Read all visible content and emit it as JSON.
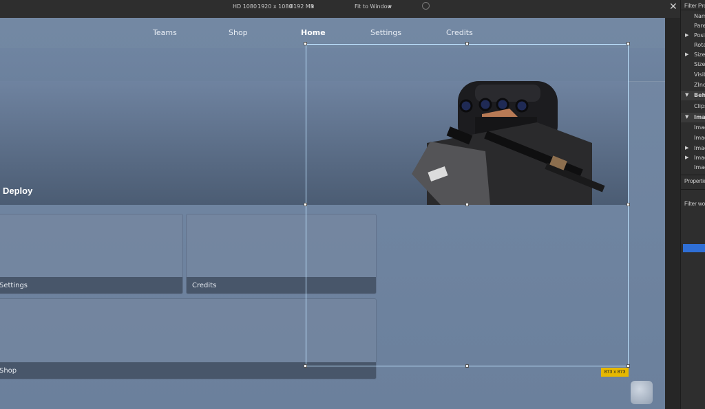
{
  "topbar": {
    "device": "HD 1080",
    "resolution": "1920 x 1080",
    "memory": "8192 MB",
    "fit": "Fit to Window",
    "close": "✕"
  },
  "nav": [
    "Teams",
    "Shop",
    "Home",
    "Settings",
    "Credits"
  ],
  "banner": {
    "label": "Deploy"
  },
  "cards": [
    "Settings",
    "Credits",
    "Shop"
  ],
  "selection": {
    "size_label": "873 x 873",
    "color": "#bfe3ff"
  },
  "panel": {
    "filter_label": "Filter Pro",
    "properties": [
      {
        "label": "Nam",
        "arrow": ""
      },
      {
        "label": "Parer",
        "arrow": ""
      },
      {
        "label": "Positi",
        "arrow": "▶"
      },
      {
        "label": "Rotat",
        "arrow": ""
      },
      {
        "label": "Size",
        "arrow": "▶"
      },
      {
        "label": "SizeC",
        "arrow": ""
      },
      {
        "label": "Visib",
        "arrow": ""
      },
      {
        "label": "ZInd",
        "arrow": ""
      },
      {
        "label": "Beha",
        "arrow": "▼",
        "header": true
      },
      {
        "label": "Clips",
        "arrow": ""
      },
      {
        "label": "Imag",
        "arrow": "▼",
        "header": true
      },
      {
        "label": "Imag",
        "arrow": ""
      },
      {
        "label": "Imag",
        "arrow": ""
      },
      {
        "label": "Imag",
        "arrow": "▶"
      },
      {
        "label": "Imag",
        "arrow": "▶"
      },
      {
        "label": "Imag",
        "arrow": ""
      }
    ],
    "properties_label": "Properties",
    "filter_workspace": "Filter wo",
    "accent": "#2f6fd6"
  },
  "colors": {
    "viewport": "#7388a3",
    "badge": "#e6b800"
  }
}
